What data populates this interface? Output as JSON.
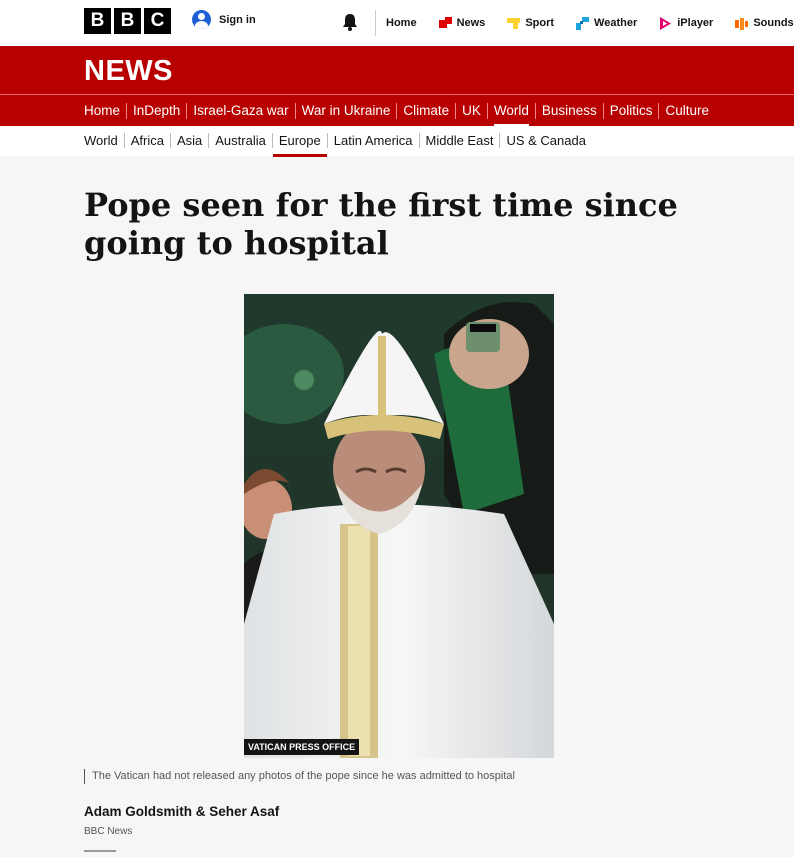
{
  "brand": {
    "letters": [
      "B",
      "B",
      "C"
    ],
    "color": "#000000"
  },
  "header": {
    "signin_label": "Sign in",
    "nav": [
      {
        "label": "Home",
        "icon": "none"
      },
      {
        "label": "News",
        "icon": "news-icon",
        "color": "#e00000"
      },
      {
        "label": "Sport",
        "icon": "sport-icon",
        "color": "#ffd230"
      },
      {
        "label": "Weather",
        "icon": "weather-icon",
        "color": "#1aa3dd"
      },
      {
        "label": "iPlayer",
        "icon": "iplayer-icon",
        "color": "#e3006e"
      },
      {
        "label": "Sounds",
        "icon": "sounds-icon",
        "color": "#ff6a00"
      }
    ]
  },
  "section": {
    "title": "NEWS",
    "accent": "#b80000"
  },
  "main_nav": [
    "Home",
    "InDepth",
    "Israel-Gaza war",
    "War in Ukraine",
    "Climate",
    "UK",
    "World",
    "Business",
    "Politics",
    "Culture"
  ],
  "main_nav_active": "World",
  "sub_nav": [
    "World",
    "Africa",
    "Asia",
    "Australia",
    "Europe",
    "Latin America",
    "Middle East",
    "US & Canada"
  ],
  "sub_nav_active": "Europe",
  "article": {
    "headline": "Pope seen for the first time since going to hospital",
    "image_credit": "VATICAN PRESS OFFICE",
    "caption": "The Vatican had not released any photos of the pope since he was admitted to hospital",
    "byline": "Adam Goldsmith & Seher Asaf",
    "byline_org": "BBC News"
  }
}
